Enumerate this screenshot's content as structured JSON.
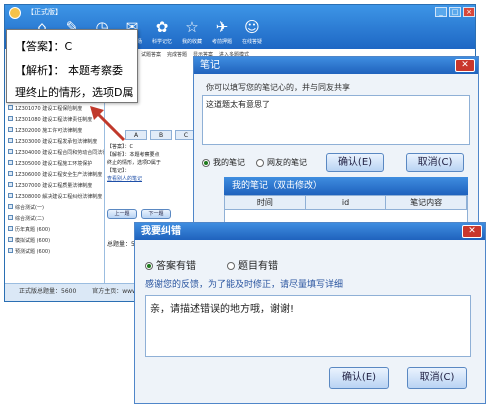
{
  "app": {
    "title": "【正式版】",
    "toolbar": [
      "首页",
      "章节练习",
      "历年真题",
      "模拟考场",
      "科学记忆",
      "我的收藏",
      "考前押题",
      "在线答疑"
    ],
    "tree": [
      "1Z301020 建设工程法律制度",
      "1Z301030 建设工程代理制度",
      "1Z301040 建设工程物权制度",
      "1Z301050 建设工程知识产权制度",
      "1Z301060 建设工程担保制度",
      "1Z301070 建设工程保险制度",
      "1Z301080 建设工程法律责任制度",
      "1Z302000 施工许可法律制度",
      "1Z303000 建设工程发承包法律制度",
      "1Z304000 建设工程合同和劳动合同法律制度",
      "1Z305000 建设工程施工环境保护",
      "1Z306000 建设工程安全生产法律制度",
      "1Z307000 建设工程质量法律制度",
      "1Z308000 解决建设工程纠纷法律制度",
      "综合测试(一)",
      "综合测试(二)",
      "历年真题 (600)",
      "模拟试题 (600)",
      "预测试题 (600)"
    ],
    "tabs": [
      "试题答案",
      "完成答题",
      "显示答案",
      "进入多题模式"
    ],
    "options": [
      "A",
      "B",
      "C",
      "D"
    ],
    "main_lines": [
      "【答案】：C",
      "【解析】：本题考察要点",
      "终止的情形，选项D属于",
      "【笔记】：",
      "查看别人的笔记"
    ],
    "nav": {
      "prev": "上一题",
      "next": "下一题"
    },
    "total": "总题量：5",
    "status": "正式版总题量：5600",
    "site": "官方主页：www.54th.com"
  },
  "popup": {
    "answer_line": "【答案】：C",
    "analysis_label": "【解析】：",
    "analysis_text": "本题考察委",
    "line3": "理终止的情形，选项D属"
  },
  "note_dialog": {
    "title": "笔记",
    "prompt": "你可以填写您的笔记心的，并与同友共享",
    "content": "这道题太有意思了",
    "radio_mine": "我的笔记",
    "radio_friends": "网友的笔记",
    "confirm": "确认(E)",
    "cancel": "取消(C)",
    "list_title": "我的笔记（双击修改）",
    "columns": [
      "时间",
      "id",
      "笔记内容"
    ]
  },
  "error_dialog": {
    "title": "我要纠错",
    "radio_answer": "答案有错",
    "radio_question": "题目有错",
    "thanks": "感谢您的反馈，为了能及时修正，请尽量填写详细",
    "content": "亲，请描述错误的地方哦，谢谢!",
    "confirm": "确认(E)",
    "cancel": "取消(C)"
  }
}
